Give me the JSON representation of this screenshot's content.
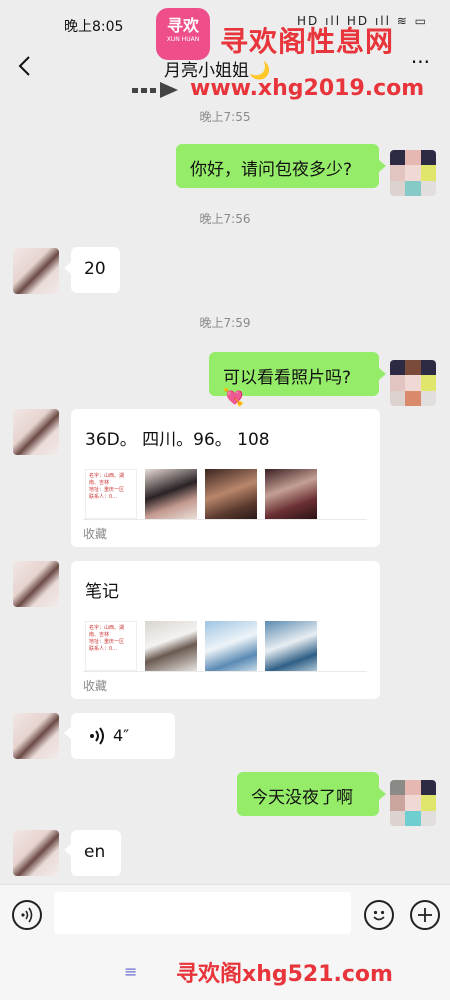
{
  "status_bar": {
    "time": "晚上8:05",
    "icons": "HD ıll HD ıll ≋ ▭"
  },
  "header": {
    "title": "月亮小姐姐🌙",
    "more": "···"
  },
  "watermark": {
    "logo_text": "寻欢",
    "logo_sub": "XUN HUAN",
    "site_name": "寻欢阁性息网",
    "url": "www.xhg2019.com",
    "bottom_text": "寻欢阁xhg521.com"
  },
  "chat": {
    "timestamps": [
      "晚上7:55",
      "晚上7:56",
      "晚上7:59"
    ],
    "messages": [
      {
        "sender": "me",
        "type": "text",
        "text": "你好，请问包夜多少?"
      },
      {
        "sender": "her",
        "type": "text",
        "text": "20"
      },
      {
        "sender": "me",
        "type": "text",
        "text": "可以看看照片吗?💘"
      },
      {
        "sender": "her",
        "type": "favorite",
        "text": "36D。 四川。96。 108",
        "footer": "收藏"
      },
      {
        "sender": "her",
        "type": "favorite",
        "text": "笔记",
        "footer": "收藏"
      },
      {
        "sender": "her",
        "type": "voice",
        "text": "4″"
      },
      {
        "sender": "me",
        "type": "text",
        "text": "今天没夜了啊"
      },
      {
        "sender": "her",
        "type": "text",
        "text": "en"
      }
    ]
  },
  "note_preview_lines": [
    "名字：山西、湖南、吉林",
    "地址：重庆一区",
    "联系人：0…"
  ],
  "input_bar": {
    "voice_icon": "voice-toggle-icon",
    "emoji_icon": "emoji-icon",
    "plus_icon": "plus-icon"
  },
  "colors": {
    "my_bubble": "#95ec69",
    "their_bubble": "#ffffff",
    "background": "#ededed",
    "watermark_red": "#e8353b"
  }
}
